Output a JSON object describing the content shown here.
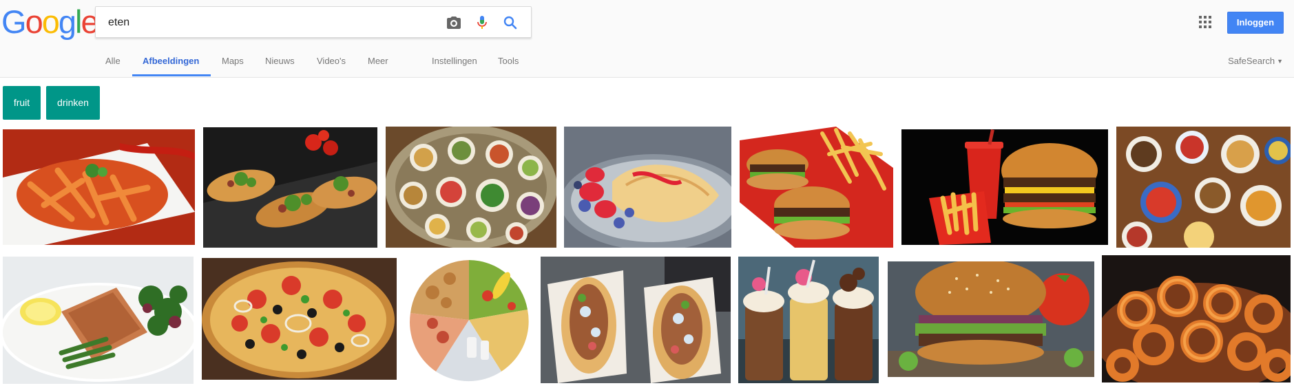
{
  "logo": {
    "letters": [
      "G",
      "o",
      "o",
      "g",
      "l",
      "e"
    ],
    "colors": [
      "#4285f4",
      "#ea4335",
      "#fbbc05",
      "#4285f4",
      "#34a853",
      "#ea4335"
    ]
  },
  "search": {
    "value": "eten",
    "camera_icon": "camera-icon",
    "mic_icon": "microphone-icon",
    "search_icon": "search-icon"
  },
  "header": {
    "apps_icon": "apps-grid-icon",
    "login_label": "Inloggen"
  },
  "tabs": [
    {
      "label": "Alle"
    },
    {
      "label": "Afbeeldingen"
    },
    {
      "label": "Maps"
    },
    {
      "label": "Nieuws"
    },
    {
      "label": "Video's"
    },
    {
      "label": "Meer"
    },
    {
      "label": "Instellingen"
    },
    {
      "label": "Tools"
    }
  ],
  "active_tab": "Afbeeldingen",
  "safesearch": {
    "label": "SafeSearch"
  },
  "chips": [
    {
      "label": "fruit"
    },
    {
      "label": "drinken"
    }
  ],
  "colors": {
    "accent": "#4285f4",
    "chip": "#009688",
    "login": "#4285f4"
  }
}
